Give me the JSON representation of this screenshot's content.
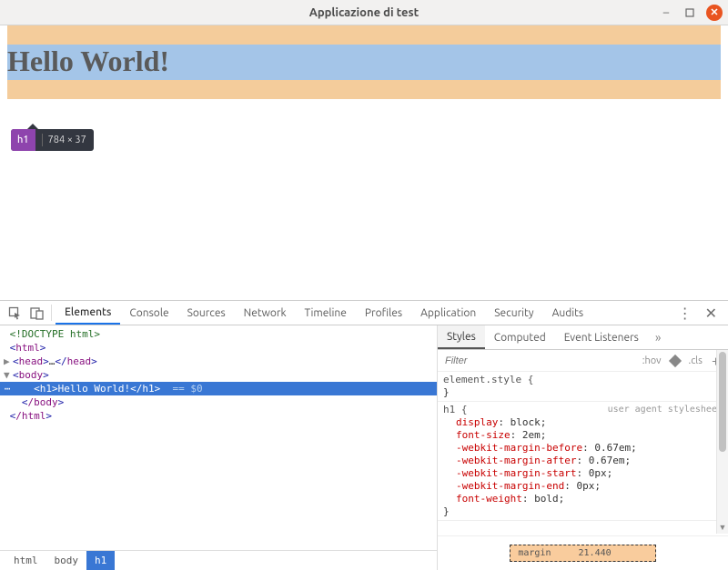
{
  "window": {
    "title": "Applicazione di test"
  },
  "page": {
    "heading": "Hello World!"
  },
  "tooltip": {
    "tag": "h1",
    "dimensions": "784 × 37"
  },
  "devtools": {
    "tabs": [
      "Elements",
      "Console",
      "Sources",
      "Network",
      "Timeline",
      "Profiles",
      "Application",
      "Security",
      "Audits"
    ],
    "active_tab": "Elements",
    "dom": {
      "doctype": "<!DOCTYPE html>",
      "html_open": "html",
      "head": "head",
      "head_ellipsis": "…",
      "body_open": "body",
      "h1_tag": "h1",
      "h1_text": "Hello World!",
      "selected_marker": "== $0",
      "body_close": "/body",
      "html_close": "/html"
    },
    "breadcrumbs": [
      "html",
      "body",
      "h1"
    ],
    "styles": {
      "tabs": [
        "Styles",
        "Computed",
        "Event Listeners"
      ],
      "filter_placeholder": "Filter",
      "hov": ":hov",
      "cls": ".cls",
      "element_style_label": "element.style {",
      "close_brace": "}",
      "rule_selector": "h1 {",
      "ua_label": "user agent stylesheet",
      "props": [
        {
          "name": "display",
          "value": "block"
        },
        {
          "name": "font-size",
          "value": "2em"
        },
        {
          "name": "-webkit-margin-before",
          "value": "0.67em"
        },
        {
          "name": "-webkit-margin-after",
          "value": "0.67em"
        },
        {
          "name": "-webkit-margin-start",
          "value": "0px"
        },
        {
          "name": "-webkit-margin-end",
          "value": "0px"
        },
        {
          "name": "font-weight",
          "value": "bold"
        }
      ],
      "boxmodel": {
        "label": "margin",
        "value": "21.440"
      }
    }
  }
}
